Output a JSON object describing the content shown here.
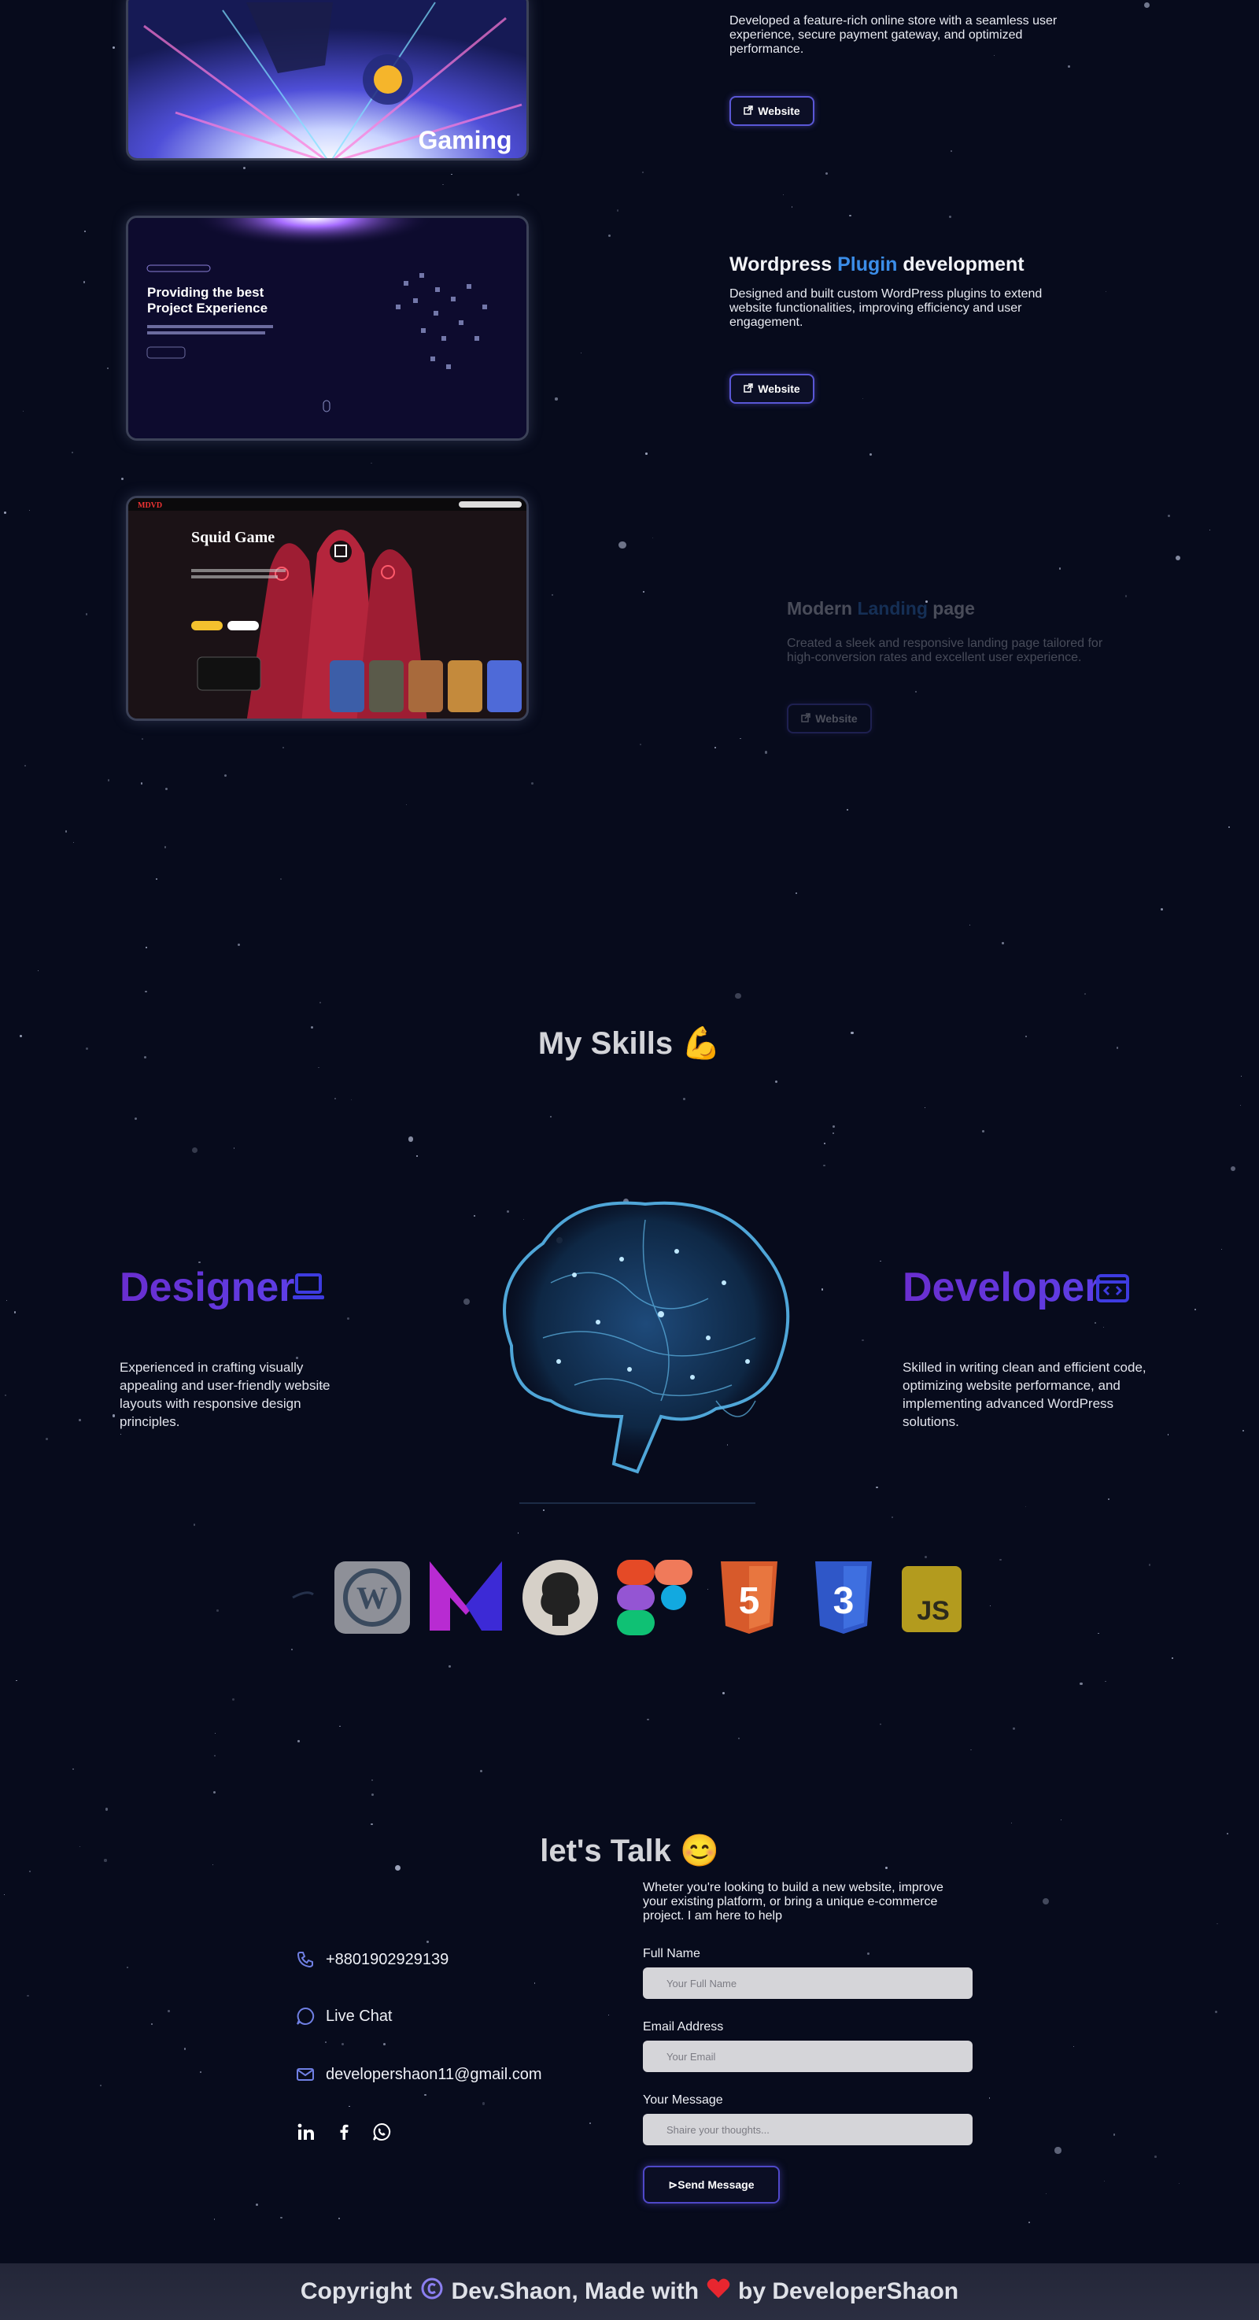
{
  "projects": [
    {
      "title_parts": [
        "",
        "",
        ""
      ],
      "desc": "Developed a feature-rich online store with a seamless user experience, secure payment gateway, and optimized performance.",
      "button": "Website",
      "image": {
        "overlay_text": "Gaming"
      }
    },
    {
      "title_parts": [
        "Wordpress ",
        "Plugin",
        " development"
      ],
      "desc": "Designed and built custom WordPress plugins to extend website functionalities, improving efficiency and user engagement.",
      "button": "Website",
      "image": {
        "heading_1": "Providing the best",
        "heading_2": "Project Experience"
      }
    },
    {
      "title_parts": [
        "Modern ",
        "Landing",
        " page"
      ],
      "desc": "Created a sleek and responsive landing page tailored for high-conversion rates and excellent user experience.",
      "button": "Website",
      "image": {
        "logo": "MDVD",
        "title": "Squid Game"
      }
    }
  ],
  "skills": {
    "title": "My Skills",
    "title_emoji": "💪",
    "designer": {
      "heading": "Designer",
      "icon": "laptop-icon",
      "text": "Experienced in crafting visually appealing and user-friendly website layouts with responsive design principles."
    },
    "developer": {
      "heading": "Developer",
      "icon": "code-window-icon",
      "text": "Skilled in writing clean and efficient code, optimizing website performance, and implementing advanced WordPress solutions."
    },
    "logos": [
      "wordpress-icon",
      "mailchimp-m-icon",
      "github-icon",
      "figma-icon",
      "html5-icon",
      "css3-icon",
      "javascript-icon"
    ]
  },
  "contact": {
    "title": "let's Talk",
    "title_emoji": "😊",
    "phone": "+8801902929139",
    "chat": "Live Chat",
    "email": "developershaon11@gmail.com",
    "intro": "Wheter you're looking to build a new website, improve your existing platform, or bring a unique e-commerce project. I am here to help",
    "full_name_label": "Full Name",
    "full_name_placeholder": "Your Full Name",
    "email_label": "Email Address",
    "email_placeholder": "Your Email",
    "message_label": "Your Message",
    "message_placeholder": "Shaire your thoughts...",
    "send_button": "Send Message"
  },
  "footer": {
    "copyright": "Copyright",
    "brand": "Dev.Shaon, Made with",
    "by": "by DeveloperShaon"
  },
  "colors": {
    "background": "#070b1c",
    "accent": "#5a57d6",
    "highlight": "#3b8de8"
  }
}
